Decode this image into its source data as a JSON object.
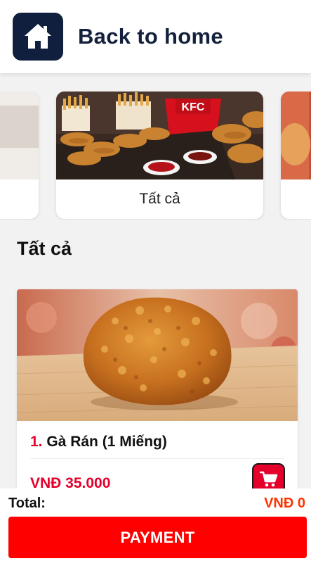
{
  "header": {
    "home_icon": "home-icon",
    "title": "Back to home"
  },
  "categories": [
    {
      "label": "",
      "image": "food-photo-partial"
    },
    {
      "label": "Tất cả",
      "image": "kfc-chicken-tenders-fries-bucket"
    },
    {
      "label": "",
      "image": "food-photo-partial"
    }
  ],
  "section": {
    "title": "Tất cả"
  },
  "products": [
    {
      "index": "1.",
      "name": "Gà Rán (1 Miếng)",
      "price": "VNĐ 35.000",
      "image": "fried-chicken-piece",
      "cart_icon": "cart-icon"
    }
  ],
  "footer": {
    "total_label": "Total:",
    "total_value": "VNĐ 0",
    "payment_label": "PAYMENT"
  },
  "colors": {
    "brand_red": "#e4002b",
    "payment_red": "#ff0000",
    "total_orange": "#ff3300",
    "header_navy": "#0f1f3d"
  }
}
